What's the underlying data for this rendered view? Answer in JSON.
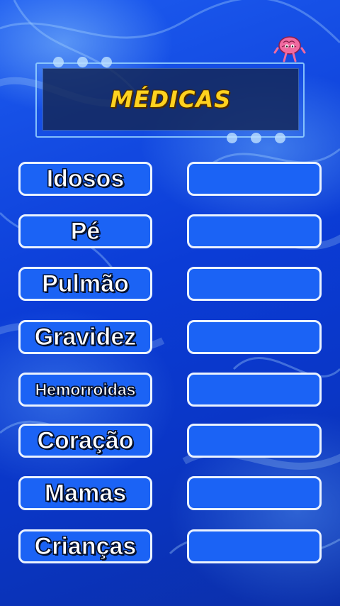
{
  "title": "MÉDICAS",
  "icons": {
    "mascot": "brain-mascot-icon"
  },
  "colors": {
    "background": "#0b3cd6",
    "button_fill": "#1b63f5",
    "button_border": "#eaf2ff",
    "title_text": "#ffd21f",
    "title_panel": "#14285a"
  },
  "words": [
    {
      "label": "Idosos"
    },
    {
      "label": "Pé"
    },
    {
      "label": "Pulmão"
    },
    {
      "label": "Gravidez"
    },
    {
      "label": "Hemorroidas"
    },
    {
      "label": "Coração"
    },
    {
      "label": "Mamas"
    },
    {
      "label": "Crianças"
    }
  ]
}
